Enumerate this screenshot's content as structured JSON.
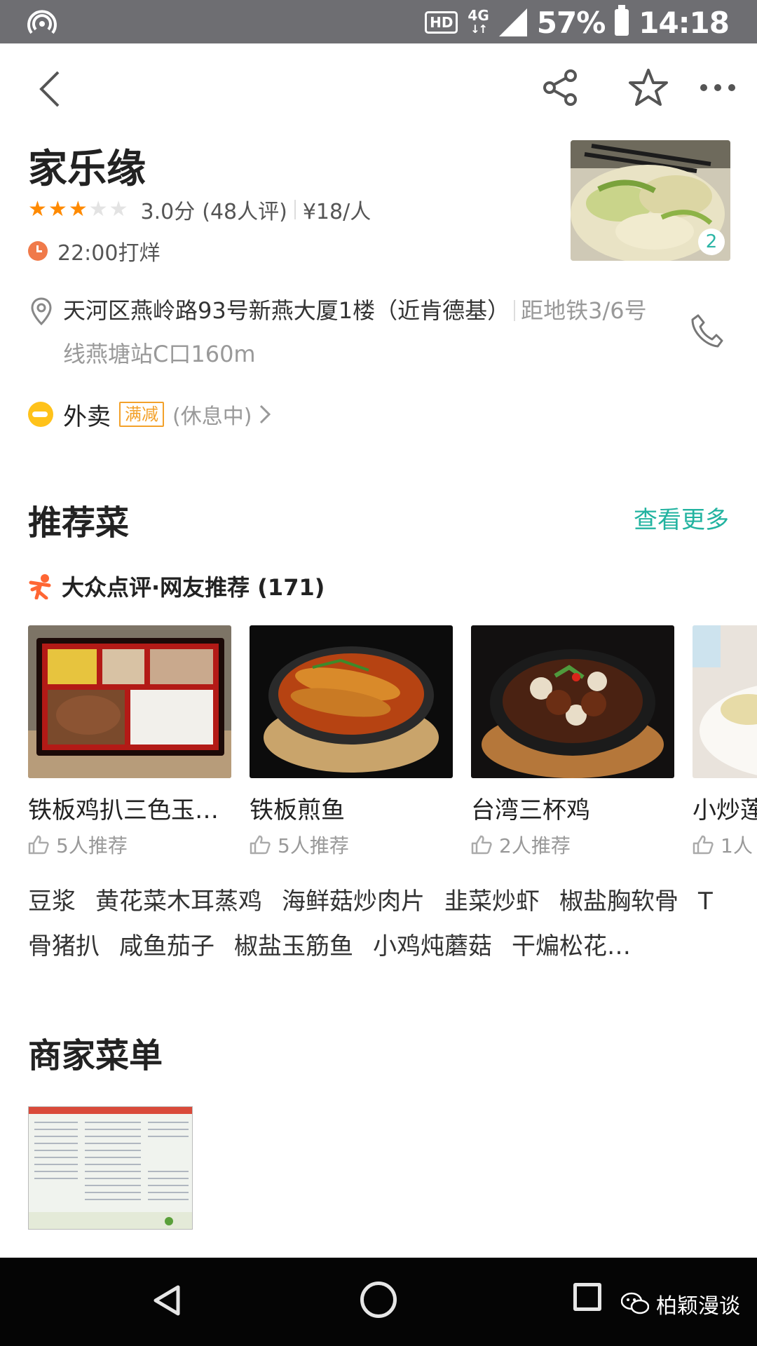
{
  "status_bar": {
    "network_hd": "HD",
    "network_type": "4G",
    "battery": "57%",
    "time": "14:18"
  },
  "shop": {
    "name": "家乐缘",
    "rating_stars": 3,
    "rating_max": 5,
    "score": "3.0分",
    "reviews": "(48人评)",
    "price": "¥18/人",
    "hours": "22:00打烊",
    "photo_count": "2",
    "address": "天河区燕岭路93号新燕大厦1楼（近肯德基）",
    "distance": "距地铁3/6号线燕塘站C口160m"
  },
  "takeout": {
    "label": "外卖",
    "badge": "满减",
    "status": "(休息中)"
  },
  "recommended": {
    "title": "推荐菜",
    "see_more": "查看更多",
    "source": "大众点评·网友推荐 (171)",
    "dishes": [
      {
        "name": "铁板鸡扒三色玉…",
        "likes": "5人推荐"
      },
      {
        "name": "铁板煎鱼",
        "likes": "5人推荐"
      },
      {
        "name": "台湾三杯鸡",
        "likes": "2人推荐"
      },
      {
        "name": "小炒莲",
        "likes": "1人"
      }
    ],
    "tags": [
      "豆浆",
      "黄花菜木耳蒸鸡",
      "海鲜菇炒肉片",
      "韭菜炒虾",
      "椒盐胸软骨",
      "T骨猪扒",
      "咸鱼茄子",
      "椒盐玉筋鱼",
      "小鸡炖蘑菇",
      "干煸松花…"
    ]
  },
  "menu": {
    "title": "商家菜单"
  },
  "watermark": "柏颖漫谈",
  "colors": {
    "accent_teal": "#22b3a0",
    "star_orange": "#ff8a00",
    "badge_orange": "#f3a12a"
  },
  "icons": [
    "back-icon",
    "share-icon",
    "star-outline-icon",
    "more-icon",
    "location-pin-icon",
    "phone-icon",
    "clock-icon",
    "takeout-icon",
    "dianping-icon",
    "thumb-up-icon"
  ]
}
